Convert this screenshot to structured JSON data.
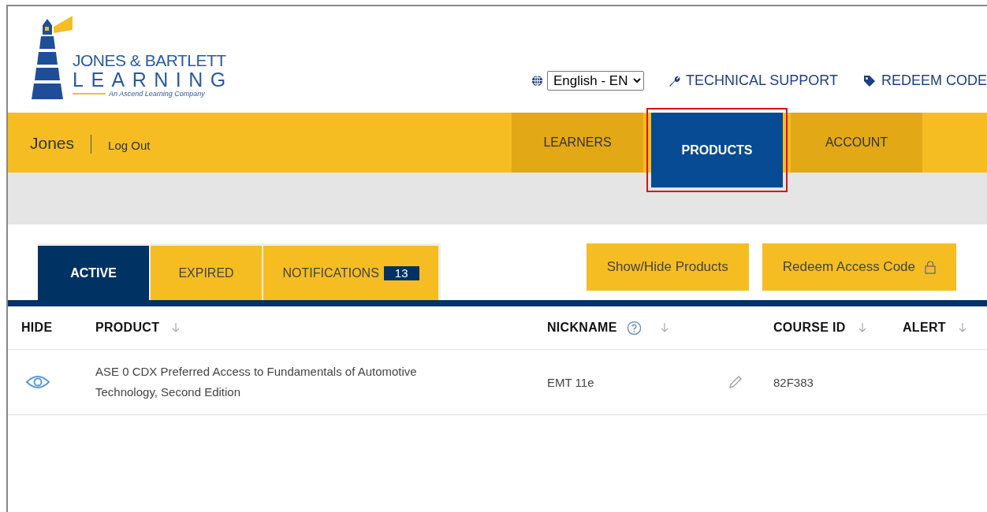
{
  "header": {
    "logo": {
      "line1": "JONES & BARTLETT",
      "line2": "LEARNING",
      "tagline": "An Ascend Learning Company"
    },
    "language_select": {
      "value": "English - EN"
    },
    "links": [
      {
        "label": "TECHNICAL SUPPORT",
        "kind": "wrench"
      },
      {
        "label": "REDEEM CODE",
        "kind": "tag"
      }
    ]
  },
  "nav": {
    "user_name": "Jones",
    "logout": "Log Out",
    "tabs": [
      {
        "label": "LEARNERS",
        "selected": false,
        "highlighted": false
      },
      {
        "label": "PRODUCTS",
        "selected": true,
        "highlighted": true
      },
      {
        "label": "ACCOUNT",
        "selected": false,
        "highlighted": false
      }
    ]
  },
  "tabs": [
    {
      "label": "ACTIVE",
      "selected": true
    },
    {
      "label": "EXPIRED",
      "selected": false
    },
    {
      "label": "NOTIFICATIONS",
      "selected": false,
      "badge": "13"
    }
  ],
  "buttons": [
    {
      "label": "Show/Hide Products",
      "kind": "plain"
    },
    {
      "label": "Redeem Access Code",
      "kind": "lock"
    }
  ],
  "table": {
    "columns": [
      {
        "label": "HIDE",
        "kind": "plain"
      },
      {
        "label": "PRODUCT",
        "kind": "sortable"
      },
      {
        "label": "NICKNAME",
        "kind": "helpsortable"
      },
      {
        "label": "COURSE ID",
        "kind": "sortable"
      },
      {
        "label": "ALERT",
        "kind": "sortable"
      }
    ],
    "rows": [
      {
        "product": "ASE 0 CDX Preferred Access to Fundamentals of Automotive Technology, Second Edition",
        "nickname": "EMT 11e",
        "course_id": "82F383"
      }
    ]
  }
}
